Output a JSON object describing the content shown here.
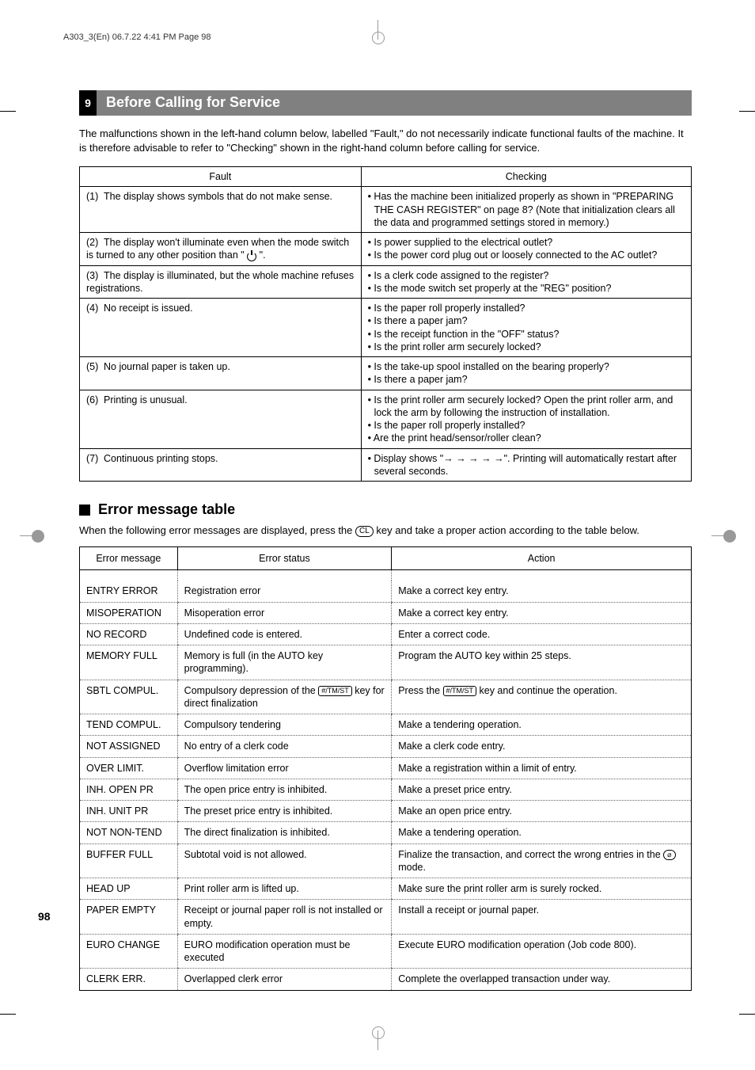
{
  "meta": {
    "header": "A303_3(En)  06.7.22 4:41 PM  Page 98",
    "page_number": "98"
  },
  "section": {
    "number": "9",
    "title": "Before Calling for Service",
    "intro": "The malfunctions shown in the left-hand column below, labelled \"Fault,\" do not necessarily indicate functional faults of the machine.  It is therefore advisable to refer to \"Checking\" shown in the right-hand column before calling for service."
  },
  "fault_table": {
    "headers": {
      "col1": "Fault",
      "col2": "Checking"
    },
    "rows": [
      {
        "fault_num": "(1)",
        "fault": "The display shows symbols that do not make sense.",
        "checking": [
          "• Has the machine been initialized properly as shown in \"PREPARING THE CASH REGISTER\" on page 8? (Note that initialization clears all the data and programmed settings stored in memory.)"
        ]
      },
      {
        "fault_num": "(2)",
        "fault_pre": "The display won't illuminate even when the mode switch is turned to any other position than \" ",
        "fault_post": " \".",
        "has_power": true,
        "checking": [
          "• Is power supplied to the electrical outlet?",
          "• Is the power cord plug out or loosely connected to the AC outlet?"
        ]
      },
      {
        "fault_num": "(3)",
        "fault": "The display is illuminated, but the whole machine refuses registrations.",
        "checking": [
          "• Is a clerk code assigned to the register?",
          "• Is the mode switch set properly at the \"REG\" position?"
        ]
      },
      {
        "fault_num": "(4)",
        "fault": "No receipt is issued.",
        "checking": [
          "• Is the paper roll properly installed?",
          "• Is there a paper jam?",
          "• Is the receipt function in the \"OFF\" status?",
          "• Is the print roller arm securely locked?"
        ]
      },
      {
        "fault_num": "(5)",
        "fault": "No journal paper is taken up.",
        "checking": [
          "• Is the take-up spool installed on the bearing properly?",
          "• Is there a paper jam?"
        ]
      },
      {
        "fault_num": "(6)",
        "fault": "Printing is unusual.",
        "checking": [
          "• Is the print roller arm securely locked? Open the print roller arm, and lock the arm by following the instruction of installation.",
          "• Is the paper roll properly installed?",
          "• Are the print head/sensor/roller clean?"
        ]
      },
      {
        "fault_num": "(7)",
        "fault": "Continuous printing stops.",
        "checking": [
          "• Display shows \"→ → → → →\". Printing will automatically restart after several seconds."
        ]
      }
    ]
  },
  "error_section": {
    "title": "Error message table",
    "intro_pre": "When the following error messages are displayed, press the ",
    "intro_key": "CL",
    "intro_post": " key and take a proper action according to the table below."
  },
  "error_table": {
    "headers": {
      "col1": "Error message",
      "col2": "Error status",
      "col3": "Action"
    },
    "rows": [
      {
        "msg": "ENTRY ERROR",
        "status": "Registration error",
        "action": "Make a correct key entry."
      },
      {
        "msg": "MISOPERATION",
        "status": "Misoperation error",
        "action": "Make a correct key entry."
      },
      {
        "msg": "NO RECORD",
        "status": "Undefined code is entered.",
        "action": "Enter a correct code."
      },
      {
        "msg": "MEMORY FULL",
        "status": "Memory is full (in the AUTO key programming).",
        "action": "Program the AUTO key within 25 steps."
      },
      {
        "msg": "SBTL COMPUL.",
        "status_pre": "Compulsory depression of the ",
        "status_key": "#/TM/ST",
        "status_post": " key for direct finalization",
        "action_pre": "Press the ",
        "action_key": "#/TM/ST",
        "action_post": " key and continue the operation.",
        "has_key": true
      },
      {
        "msg": "TEND COMPUL.",
        "status": "Compulsory tendering",
        "action": "Make a tendering operation."
      },
      {
        "msg": "NOT ASSIGNED",
        "status": "No entry of a clerk code",
        "action": "Make a clerk code entry."
      },
      {
        "msg": "OVER LIMIT.",
        "status": "Overflow limitation error",
        "action": "Make a registration within a limit of entry."
      },
      {
        "msg": "INH. OPEN PR",
        "status": "The open price entry is inhibited.",
        "action": "Make a preset price entry."
      },
      {
        "msg": "INH. UNIT PR",
        "status": "The preset price entry is inhibited.",
        "action": "Make an open price entry."
      },
      {
        "msg": "NOT NON-TEND",
        "status": "The direct finalization is inhibited.",
        "action": "Make a tendering operation."
      },
      {
        "msg": "BUFFER FULL",
        "status": "Subtotal void is not allowed.",
        "action_pre": "Finalize the transaction, and correct the wrong entries in the ",
        "action_void": "⌀",
        "action_post": " mode.",
        "has_void": true
      },
      {
        "msg": "HEAD UP",
        "status": "Print roller arm is lifted up.",
        "action": "Make sure the print roller arm is surely rocked."
      },
      {
        "msg": "PAPER EMPTY",
        "status": "Receipt or journal paper roll is not installed or empty.",
        "action": "Install a receipt or journal paper."
      },
      {
        "msg": "EURO CHANGE",
        "status": "EURO modification operation must be executed",
        "action": "Execute EURO modification operation (Job code 800)."
      },
      {
        "msg": "CLERK ERR.",
        "status": "Overlapped clerk error",
        "action": "Complete the overlapped transaction under way."
      }
    ]
  }
}
